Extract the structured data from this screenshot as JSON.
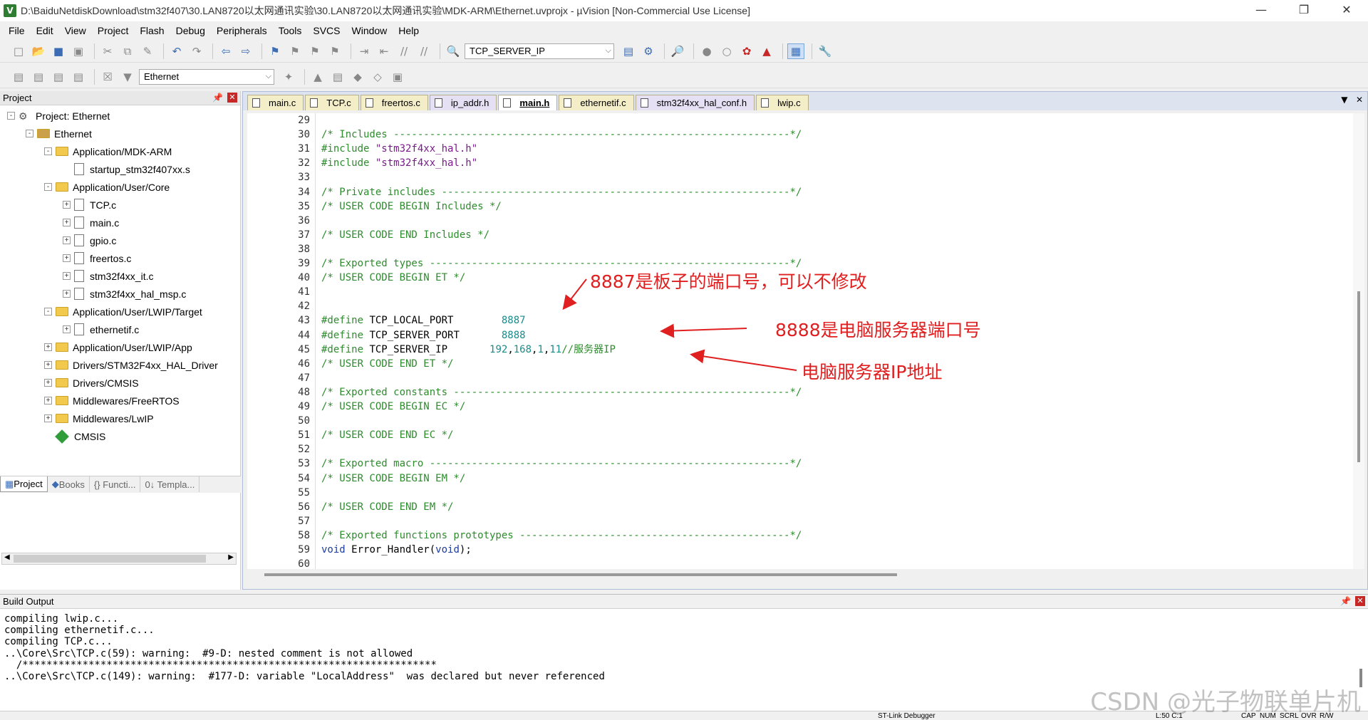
{
  "window": {
    "title": "D:\\BaiduNetdiskDownload\\stm32f407\\30.LAN8720以太网通讯实验\\30.LAN8720以太网通讯实验\\MDK-ARM\\Ethernet.uvprojx - µVision  [Non-Commercial Use License]",
    "app_icon": "V"
  },
  "menu": [
    "File",
    "Edit",
    "View",
    "Project",
    "Flash",
    "Debug",
    "Peripherals",
    "Tools",
    "SVCS",
    "Window",
    "Help"
  ],
  "toolbar": {
    "find_value": "TCP_SERVER_IP",
    "target_value": "Ethernet"
  },
  "project_panel": {
    "title": "Project",
    "tree": [
      {
        "label": "Project: Ethernet",
        "level": 0,
        "icon": "project",
        "exp": "-"
      },
      {
        "label": "Ethernet",
        "level": 1,
        "icon": "target",
        "exp": "-"
      },
      {
        "label": "Application/MDK-ARM",
        "level": 2,
        "icon": "folder",
        "exp": "-"
      },
      {
        "label": "startup_stm32f407xx.s",
        "level": 3,
        "icon": "file",
        "exp": ""
      },
      {
        "label": "Application/User/Core",
        "level": 2,
        "icon": "folder",
        "exp": "-"
      },
      {
        "label": "TCP.c",
        "level": 3,
        "icon": "file",
        "exp": "+"
      },
      {
        "label": "main.c",
        "level": 3,
        "icon": "file",
        "exp": "+"
      },
      {
        "label": "gpio.c",
        "level": 3,
        "icon": "file",
        "exp": "+"
      },
      {
        "label": "freertos.c",
        "level": 3,
        "icon": "file",
        "exp": "+"
      },
      {
        "label": "stm32f4xx_it.c",
        "level": 3,
        "icon": "file",
        "exp": "+"
      },
      {
        "label": "stm32f4xx_hal_msp.c",
        "level": 3,
        "icon": "file",
        "exp": "+"
      },
      {
        "label": "Application/User/LWIP/Target",
        "level": 2,
        "icon": "folder",
        "exp": "-"
      },
      {
        "label": "ethernetif.c",
        "level": 3,
        "icon": "file",
        "exp": "+"
      },
      {
        "label": "Application/User/LWIP/App",
        "level": 2,
        "icon": "folder",
        "exp": "+"
      },
      {
        "label": "Drivers/STM32F4xx_HAL_Driver",
        "level": 2,
        "icon": "folder",
        "exp": "+"
      },
      {
        "label": "Drivers/CMSIS",
        "level": 2,
        "icon": "folder",
        "exp": "+"
      },
      {
        "label": "Middlewares/FreeRTOS",
        "level": 2,
        "icon": "folder",
        "exp": "+"
      },
      {
        "label": "Middlewares/LwIP",
        "level": 2,
        "icon": "folder",
        "exp": "+"
      },
      {
        "label": "CMSIS",
        "level": 2,
        "icon": "gem",
        "exp": ""
      }
    ],
    "tabs": [
      "Project",
      "Books",
      "{} Functi...",
      "0↓ Templa..."
    ]
  },
  "editor": {
    "tabs": [
      {
        "label": "main.c",
        "type": "c",
        "active": false
      },
      {
        "label": "TCP.c",
        "type": "c",
        "active": false
      },
      {
        "label": "freertos.c",
        "type": "c",
        "active": false
      },
      {
        "label": "ip_addr.h",
        "type": "h",
        "active": false
      },
      {
        "label": "main.h",
        "type": "h",
        "active": true
      },
      {
        "label": "ethernetif.c",
        "type": "c",
        "active": false
      },
      {
        "label": "stm32f4xx_hal_conf.h",
        "type": "h",
        "active": false
      },
      {
        "label": "lwip.c",
        "type": "c",
        "active": false
      }
    ],
    "lines": [
      {
        "n": "29",
        "parts": [
          {
            "t": "",
            "c": "tx"
          }
        ]
      },
      {
        "n": "30",
        "parts": [
          {
            "t": "/* Includes ------------------------------------------------------------------*/",
            "c": "cm"
          }
        ]
      },
      {
        "n": "31",
        "parts": [
          {
            "t": "#include ",
            "c": "pp"
          },
          {
            "t": "\"stm32f4xx_hal.h\"",
            "c": "st"
          }
        ]
      },
      {
        "n": "32",
        "parts": [
          {
            "t": "#include ",
            "c": "pp"
          },
          {
            "t": "\"stm32f4xx_hal.h\"",
            "c": "st"
          }
        ]
      },
      {
        "n": "33",
        "parts": [
          {
            "t": "",
            "c": "tx"
          }
        ]
      },
      {
        "n": "34",
        "parts": [
          {
            "t": "/* Private includes ----------------------------------------------------------*/",
            "c": "cm"
          }
        ]
      },
      {
        "n": "35",
        "parts": [
          {
            "t": "/* USER CODE BEGIN Includes */",
            "c": "cm"
          }
        ]
      },
      {
        "n": "36",
        "parts": [
          {
            "t": "",
            "c": "tx"
          }
        ]
      },
      {
        "n": "37",
        "parts": [
          {
            "t": "/* USER CODE END Includes */",
            "c": "cm"
          }
        ]
      },
      {
        "n": "38",
        "parts": [
          {
            "t": "",
            "c": "tx"
          }
        ]
      },
      {
        "n": "39",
        "parts": [
          {
            "t": "/* Exported types ------------------------------------------------------------*/",
            "c": "cm"
          }
        ]
      },
      {
        "n": "40",
        "parts": [
          {
            "t": "/* USER CODE BEGIN ET */",
            "c": "cm"
          }
        ]
      },
      {
        "n": "41",
        "parts": [
          {
            "t": "",
            "c": "tx"
          }
        ]
      },
      {
        "n": "42",
        "parts": [
          {
            "t": "",
            "c": "tx"
          }
        ]
      },
      {
        "n": "43",
        "parts": [
          {
            "t": "#define ",
            "c": "pp"
          },
          {
            "t": "TCP_LOCAL_PORT        ",
            "c": "tx"
          },
          {
            "t": "8887",
            "c": "nm"
          }
        ]
      },
      {
        "n": "44",
        "parts": [
          {
            "t": "#define ",
            "c": "pp"
          },
          {
            "t": "TCP_SERVER_PORT       ",
            "c": "tx"
          },
          {
            "t": "8888",
            "c": "nm"
          }
        ]
      },
      {
        "n": "45",
        "parts": [
          {
            "t": "#define ",
            "c": "pp"
          },
          {
            "t": "TCP_SERVER_IP       ",
            "c": "tx"
          },
          {
            "t": "192",
            "c": "nm"
          },
          {
            "t": ",",
            "c": "tx"
          },
          {
            "t": "168",
            "c": "nm"
          },
          {
            "t": ",",
            "c": "tx"
          },
          {
            "t": "1",
            "c": "nm"
          },
          {
            "t": ",",
            "c": "tx"
          },
          {
            "t": "11",
            "c": "nm"
          },
          {
            "t": "//服务器IP",
            "c": "cm"
          }
        ]
      },
      {
        "n": "46",
        "parts": [
          {
            "t": "/* USER CODE END ET */",
            "c": "cm"
          }
        ]
      },
      {
        "n": "47",
        "parts": [
          {
            "t": "",
            "c": "tx"
          }
        ]
      },
      {
        "n": "48",
        "parts": [
          {
            "t": "/* Exported constants --------------------------------------------------------*/",
            "c": "cm"
          }
        ]
      },
      {
        "n": "49",
        "parts": [
          {
            "t": "/* USER CODE BEGIN EC */",
            "c": "cm"
          }
        ]
      },
      {
        "n": "50",
        "parts": [
          {
            "t": "",
            "c": "tx"
          }
        ]
      },
      {
        "n": "51",
        "parts": [
          {
            "t": "/* USER CODE END EC */",
            "c": "cm"
          }
        ]
      },
      {
        "n": "52",
        "parts": [
          {
            "t": "",
            "c": "tx"
          }
        ]
      },
      {
        "n": "53",
        "parts": [
          {
            "t": "/* Exported macro ------------------------------------------------------------*/",
            "c": "cm"
          }
        ]
      },
      {
        "n": "54",
        "parts": [
          {
            "t": "/* USER CODE BEGIN EM */",
            "c": "cm"
          }
        ]
      },
      {
        "n": "55",
        "parts": [
          {
            "t": "",
            "c": "tx"
          }
        ]
      },
      {
        "n": "56",
        "parts": [
          {
            "t": "/* USER CODE END EM */",
            "c": "cm"
          }
        ]
      },
      {
        "n": "57",
        "parts": [
          {
            "t": "",
            "c": "tx"
          }
        ]
      },
      {
        "n": "58",
        "parts": [
          {
            "t": "/* Exported functions prototypes ---------------------------------------------*/",
            "c": "cm"
          }
        ]
      },
      {
        "n": "59",
        "parts": [
          {
            "t": "void ",
            "c": "kw"
          },
          {
            "t": "Error_Handler(",
            "c": "tx"
          },
          {
            "t": "void",
            "c": "kw"
          },
          {
            "t": ");",
            "c": "tx"
          }
        ]
      },
      {
        "n": "60",
        "parts": [
          {
            "t": "",
            "c": "tx"
          }
        ]
      }
    ]
  },
  "annotations": {
    "a1": "8887是板子的端口号，可以不修改",
    "a2": "8888是电脑服务器端口号",
    "a3": "电脑服务器IP地址"
  },
  "build_output": {
    "title": "Build Output",
    "lines": [
      "compiling lwip.c...",
      "compiling ethernetif.c...",
      "compiling TCP.c...",
      "..\\Core\\Src\\TCP.c(59): warning:  #9-D: nested comment is not allowed",
      "  /*********************************************************************",
      "..\\Core\\Src\\TCP.c(149): warning:  #177-D: variable \"LocalAddress\"  was declared but never referenced"
    ]
  },
  "status": {
    "debugger": "ST-Link Debugger",
    "position": "L:50 C:1",
    "caps": "CAP",
    "num": "NUM",
    "scrl": "SCRL",
    "ovr": "OVR",
    "raw": "R/W"
  },
  "watermark": "CSDN @光子物联单片机",
  "colors": {
    "annotation": "#e02020",
    "comment": "#2e8b2e",
    "number": "#1a8b8b",
    "string": "#7a1a8b"
  }
}
